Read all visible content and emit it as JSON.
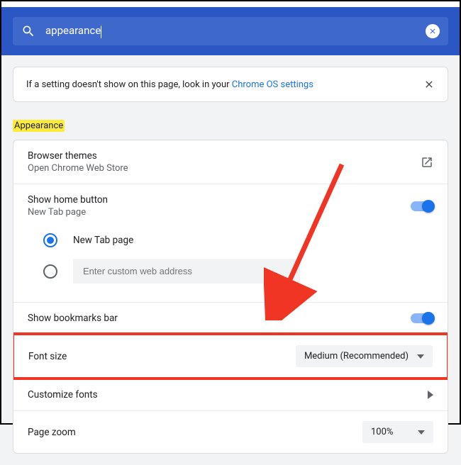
{
  "search": {
    "value": "appearance"
  },
  "banner": {
    "text_prefix": "If a setting doesn't show on this page, look in your ",
    "link_text": "Chrome OS settings"
  },
  "section": {
    "title": "Appearance"
  },
  "themes": {
    "title": "Browser themes",
    "sub": "Open Chrome Web Store"
  },
  "home_button": {
    "title": "Show home button",
    "sub": "New Tab page",
    "radio1": "New Tab page",
    "custom_placeholder": "Enter custom web address"
  },
  "bookmarks": {
    "title": "Show bookmarks bar"
  },
  "font_size": {
    "title": "Font size",
    "value": "Medium (Recommended)"
  },
  "fonts": {
    "title": "Customize fonts"
  },
  "zoom": {
    "title": "Page zoom",
    "value": "100%"
  }
}
